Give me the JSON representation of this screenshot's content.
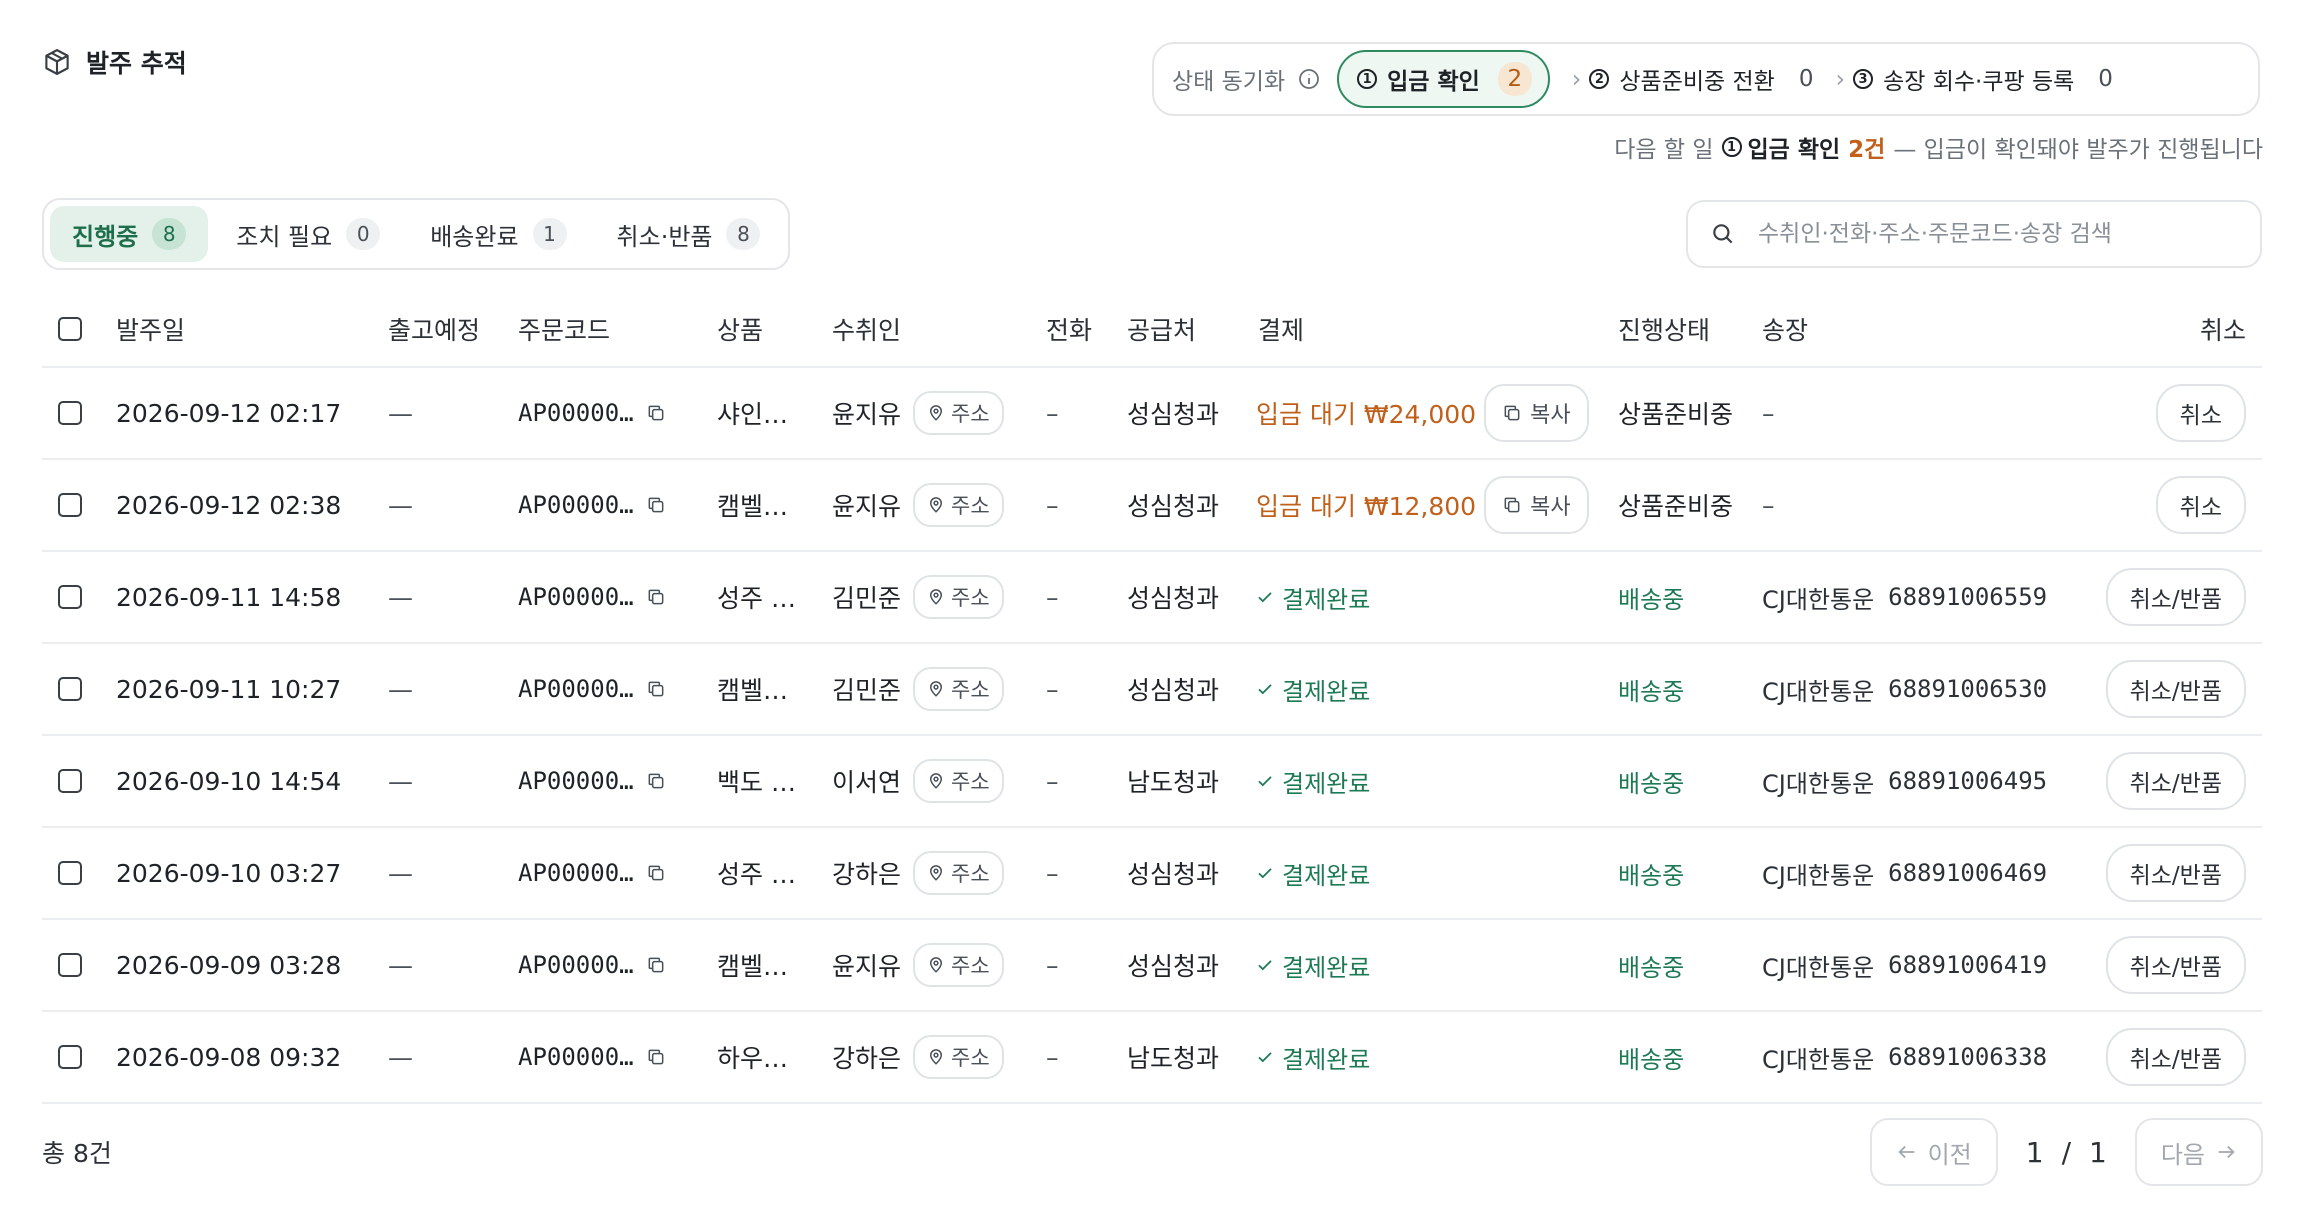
{
  "header": {
    "title": "발주 추적"
  },
  "sync": {
    "label": "상태 동기화",
    "steps": [
      {
        "num": "1",
        "label": "입금 확인",
        "count": "2"
      },
      {
        "num": "2",
        "label": "상품준비중 전환",
        "count": "0"
      },
      {
        "num": "3",
        "label": "송장 회수·쿠팡 등록",
        "count": "0"
      }
    ],
    "hint": {
      "prefix": "다음 할 일",
      "step_num": "1",
      "step_label": "입금 확인",
      "count": "2건",
      "suffix": "— 입금이 확인돼야 발주가 진행됩니다"
    }
  },
  "tabs": [
    {
      "label": "진행중",
      "count": "8"
    },
    {
      "label": "조치 필요",
      "count": "0"
    },
    {
      "label": "배송완료",
      "count": "1"
    },
    {
      "label": "취소·반품",
      "count": "8"
    }
  ],
  "search": {
    "placeholder": "수취인·전화·주소·주문코드·송장 검색"
  },
  "table": {
    "headers": {
      "date": "발주일",
      "ship": "출고예정",
      "code": "주문코드",
      "product": "상품",
      "recipient": "수취인",
      "phone": "전화",
      "supplier": "공급처",
      "payment": "결제",
      "status": "진행상태",
      "invoice": "송장",
      "cancel": "취소"
    },
    "address_label": "주소",
    "copy_label": "복사",
    "rows": [
      {
        "date": "2026-09-12 02:17",
        "ship": "—",
        "code": "AP00000…",
        "product": "샤인…",
        "recipient": "윤지유",
        "phone": "–",
        "supplier": "성심청과",
        "payment_type": "pending",
        "payment": "입금 대기 ₩24,000",
        "status": "상품준비중",
        "status_type": "prep",
        "carrier": "",
        "invoice": "–",
        "cancel": "취소"
      },
      {
        "date": "2026-09-12 02:38",
        "ship": "—",
        "code": "AP00000…",
        "product": "캠벨…",
        "recipient": "윤지유",
        "phone": "–",
        "supplier": "성심청과",
        "payment_type": "pending",
        "payment": "입금 대기 ₩12,800",
        "status": "상품준비중",
        "status_type": "prep",
        "carrier": "",
        "invoice": "–",
        "cancel": "취소"
      },
      {
        "date": "2026-09-11 14:58",
        "ship": "—",
        "code": "AP00000…",
        "product": "성주 …",
        "recipient": "김민준",
        "phone": "–",
        "supplier": "성심청과",
        "payment_type": "paid",
        "payment": "결제완료",
        "status": "배송중",
        "status_type": "shipping",
        "carrier": "CJ대한통운",
        "invoice": "68891006559",
        "cancel": "취소/반품"
      },
      {
        "date": "2026-09-11 10:27",
        "ship": "—",
        "code": "AP00000…",
        "product": "캠벨…",
        "recipient": "김민준",
        "phone": "–",
        "supplier": "성심청과",
        "payment_type": "paid",
        "payment": "결제완료",
        "status": "배송중",
        "status_type": "shipping",
        "carrier": "CJ대한통운",
        "invoice": "68891006530",
        "cancel": "취소/반품"
      },
      {
        "date": "2026-09-10 14:54",
        "ship": "—",
        "code": "AP00000…",
        "product": "백도 …",
        "recipient": "이서연",
        "phone": "–",
        "supplier": "남도청과",
        "payment_type": "paid",
        "payment": "결제완료",
        "status": "배송중",
        "status_type": "shipping",
        "carrier": "CJ대한통운",
        "invoice": "68891006495",
        "cancel": "취소/반품"
      },
      {
        "date": "2026-09-10 03:27",
        "ship": "—",
        "code": "AP00000…",
        "product": "성주 …",
        "recipient": "강하은",
        "phone": "–",
        "supplier": "성심청과",
        "payment_type": "paid",
        "payment": "결제완료",
        "status": "배송중",
        "status_type": "shipping",
        "carrier": "CJ대한통운",
        "invoice": "68891006469",
        "cancel": "취소/반품"
      },
      {
        "date": "2026-09-09 03:28",
        "ship": "—",
        "code": "AP00000…",
        "product": "캠벨…",
        "recipient": "윤지유",
        "phone": "–",
        "supplier": "성심청과",
        "payment_type": "paid",
        "payment": "결제완료",
        "status": "배송중",
        "status_type": "shipping",
        "carrier": "CJ대한통운",
        "invoice": "68891006419",
        "cancel": "취소/반품"
      },
      {
        "date": "2026-09-08 09:32",
        "ship": "—",
        "code": "AP00000…",
        "product": "하우…",
        "recipient": "강하은",
        "phone": "–",
        "supplier": "남도청과",
        "payment_type": "paid",
        "payment": "결제완료",
        "status": "배송중",
        "status_type": "shipping",
        "carrier": "CJ대한통운",
        "invoice": "68891006338",
        "cancel": "취소/반품"
      }
    ]
  },
  "footer": {
    "total": "총 8건",
    "prev_label": "이전",
    "next_label": "다음",
    "page_current": "1",
    "page_sep": "/",
    "page_total": "1"
  },
  "colors": {
    "accent_green": "#1d7a55",
    "pending_orange": "#c0601a",
    "border": "#e3e5e8"
  },
  "icons": {
    "title": "package-icon",
    "info": "info-icon",
    "search": "search-icon",
    "copy": "copy-icon",
    "address": "map-pin-icon",
    "paid": "check-icon"
  }
}
